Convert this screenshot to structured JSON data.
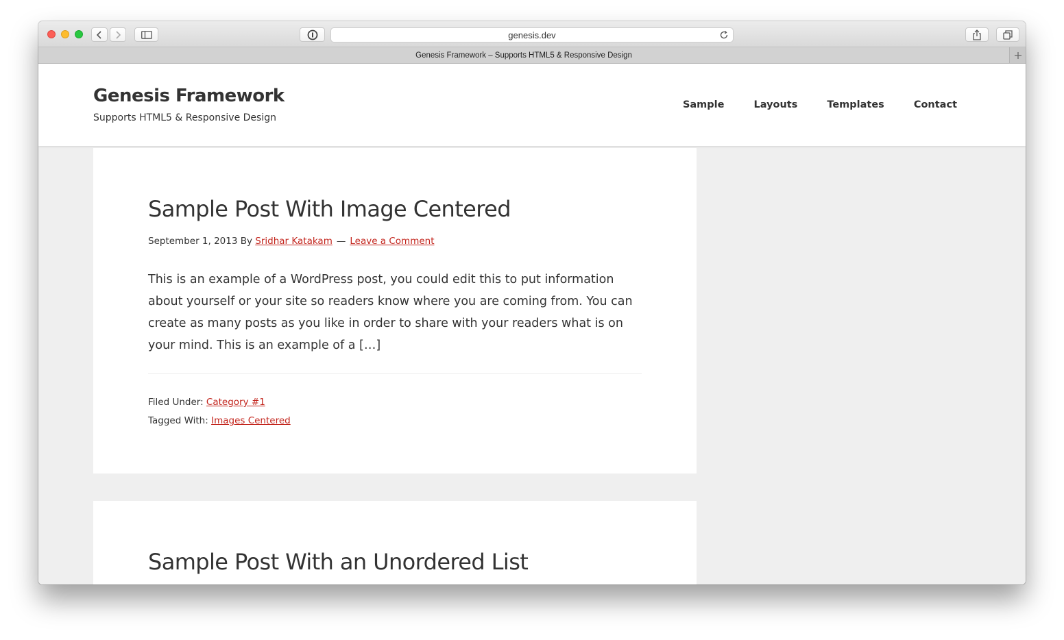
{
  "browser": {
    "url": "genesis.dev",
    "tab_title": "Genesis Framework – Supports HTML5 & Responsive Design",
    "icons": [
      "back-icon",
      "forward-icon",
      "sidebar-icon",
      "info-icon",
      "reload-icon",
      "share-icon",
      "tabs-icon",
      "new-tab-icon"
    ],
    "traffic_light_colors": {
      "close": "#fc5f57",
      "minimize": "#fdbc2e",
      "zoom": "#28c840"
    }
  },
  "site": {
    "title": "Genesis Framework",
    "description": "Supports HTML5 & Responsive Design",
    "nav": [
      "Sample",
      "Layouts",
      "Templates",
      "Contact"
    ],
    "link_color": "#c3251d"
  },
  "posts": [
    {
      "title": "Sample Post With Image Centered",
      "date_by": "September 1, 2013 By ",
      "author": "Sridhar Katakam",
      "separator": "—",
      "comment_link": "Leave a Comment",
      "excerpt": "This is an example of a WordPress post, you could edit this to put information about yourself or your site so readers know where you are coming from. You can create as many posts as you like in order to share with your readers what is on your mind. This is an example of a […]",
      "filed_under_label": "Filed Under: ",
      "category": "Category #1",
      "tagged_with_label": "Tagged With: ",
      "tag": "Images Centered"
    },
    {
      "title": "Sample Post With an Unordered List"
    }
  ]
}
